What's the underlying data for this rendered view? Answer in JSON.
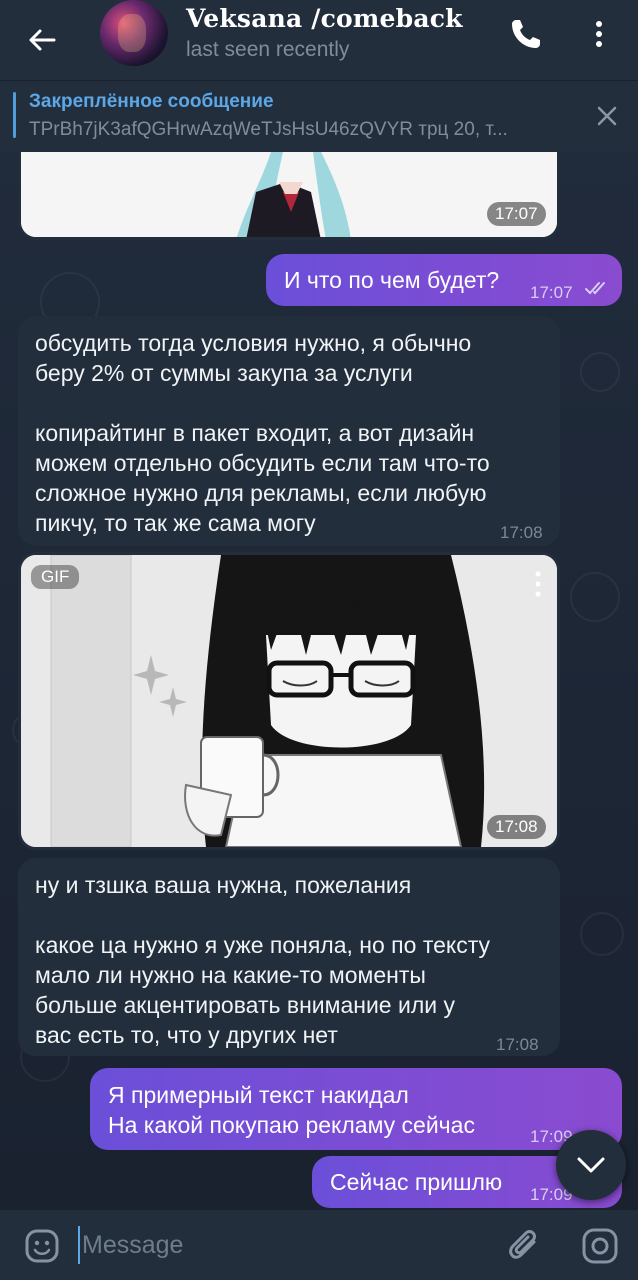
{
  "header": {
    "title": "Veksana /comeback",
    "status": "last seen recently"
  },
  "pinned": {
    "title": "Закреплённое сообщение",
    "text": "TPrBh7jK3afQGHrwAzqWeTJsHsU46zQVYR трц 20, т..."
  },
  "messages": [
    {
      "type": "media",
      "time": "17:07"
    },
    {
      "type": "out",
      "text": "И что по чем будет?",
      "time": "17:07"
    },
    {
      "type": "in",
      "lines": [
        "обсудить тогда условия нужно, я обычно",
        "беру 2% от суммы закупа за услуги",
        "",
        "копирайтинг в пакет входит, а вот дизайн",
        "можем отдельно обсудить если там что-то",
        "сложное нужно для рекламы, если любую",
        "пикчу, то так же сама могу"
      ],
      "time": "17:08"
    },
    {
      "type": "gif",
      "badge": "GIF",
      "time": "17:08"
    },
    {
      "type": "in",
      "lines": [
        "ну и тзшка ваша нужна, пожелания",
        "",
        "какое ца нужно я уже поняла, но по тексту",
        "мало ли нужно на какие-то моменты",
        "больше акцентировать внимание или у",
        "вас есть то, что у других нет"
      ],
      "time": "17:08"
    },
    {
      "type": "out",
      "lines": [
        "Я примерный текст накидал",
        "На какой покупаю рекламу сейчас"
      ],
      "time": "17:09"
    },
    {
      "type": "out",
      "text": "Сейчас пришлю",
      "time": "17:09"
    }
  ],
  "input": {
    "placeholder": "Message"
  },
  "colors": {
    "header_bg": "#232e3c",
    "incoming_bubble": "#232e3c",
    "outgoing_bubble": "#7b4dd4",
    "accent": "#5ca7e6"
  },
  "icons": [
    "back-arrow-icon",
    "phone-icon",
    "more-vertical-icon",
    "close-icon",
    "double-check-icon",
    "more-vertical-icon",
    "chevron-down-icon",
    "emoji-icon",
    "paperclip-icon",
    "camera-icon"
  ]
}
